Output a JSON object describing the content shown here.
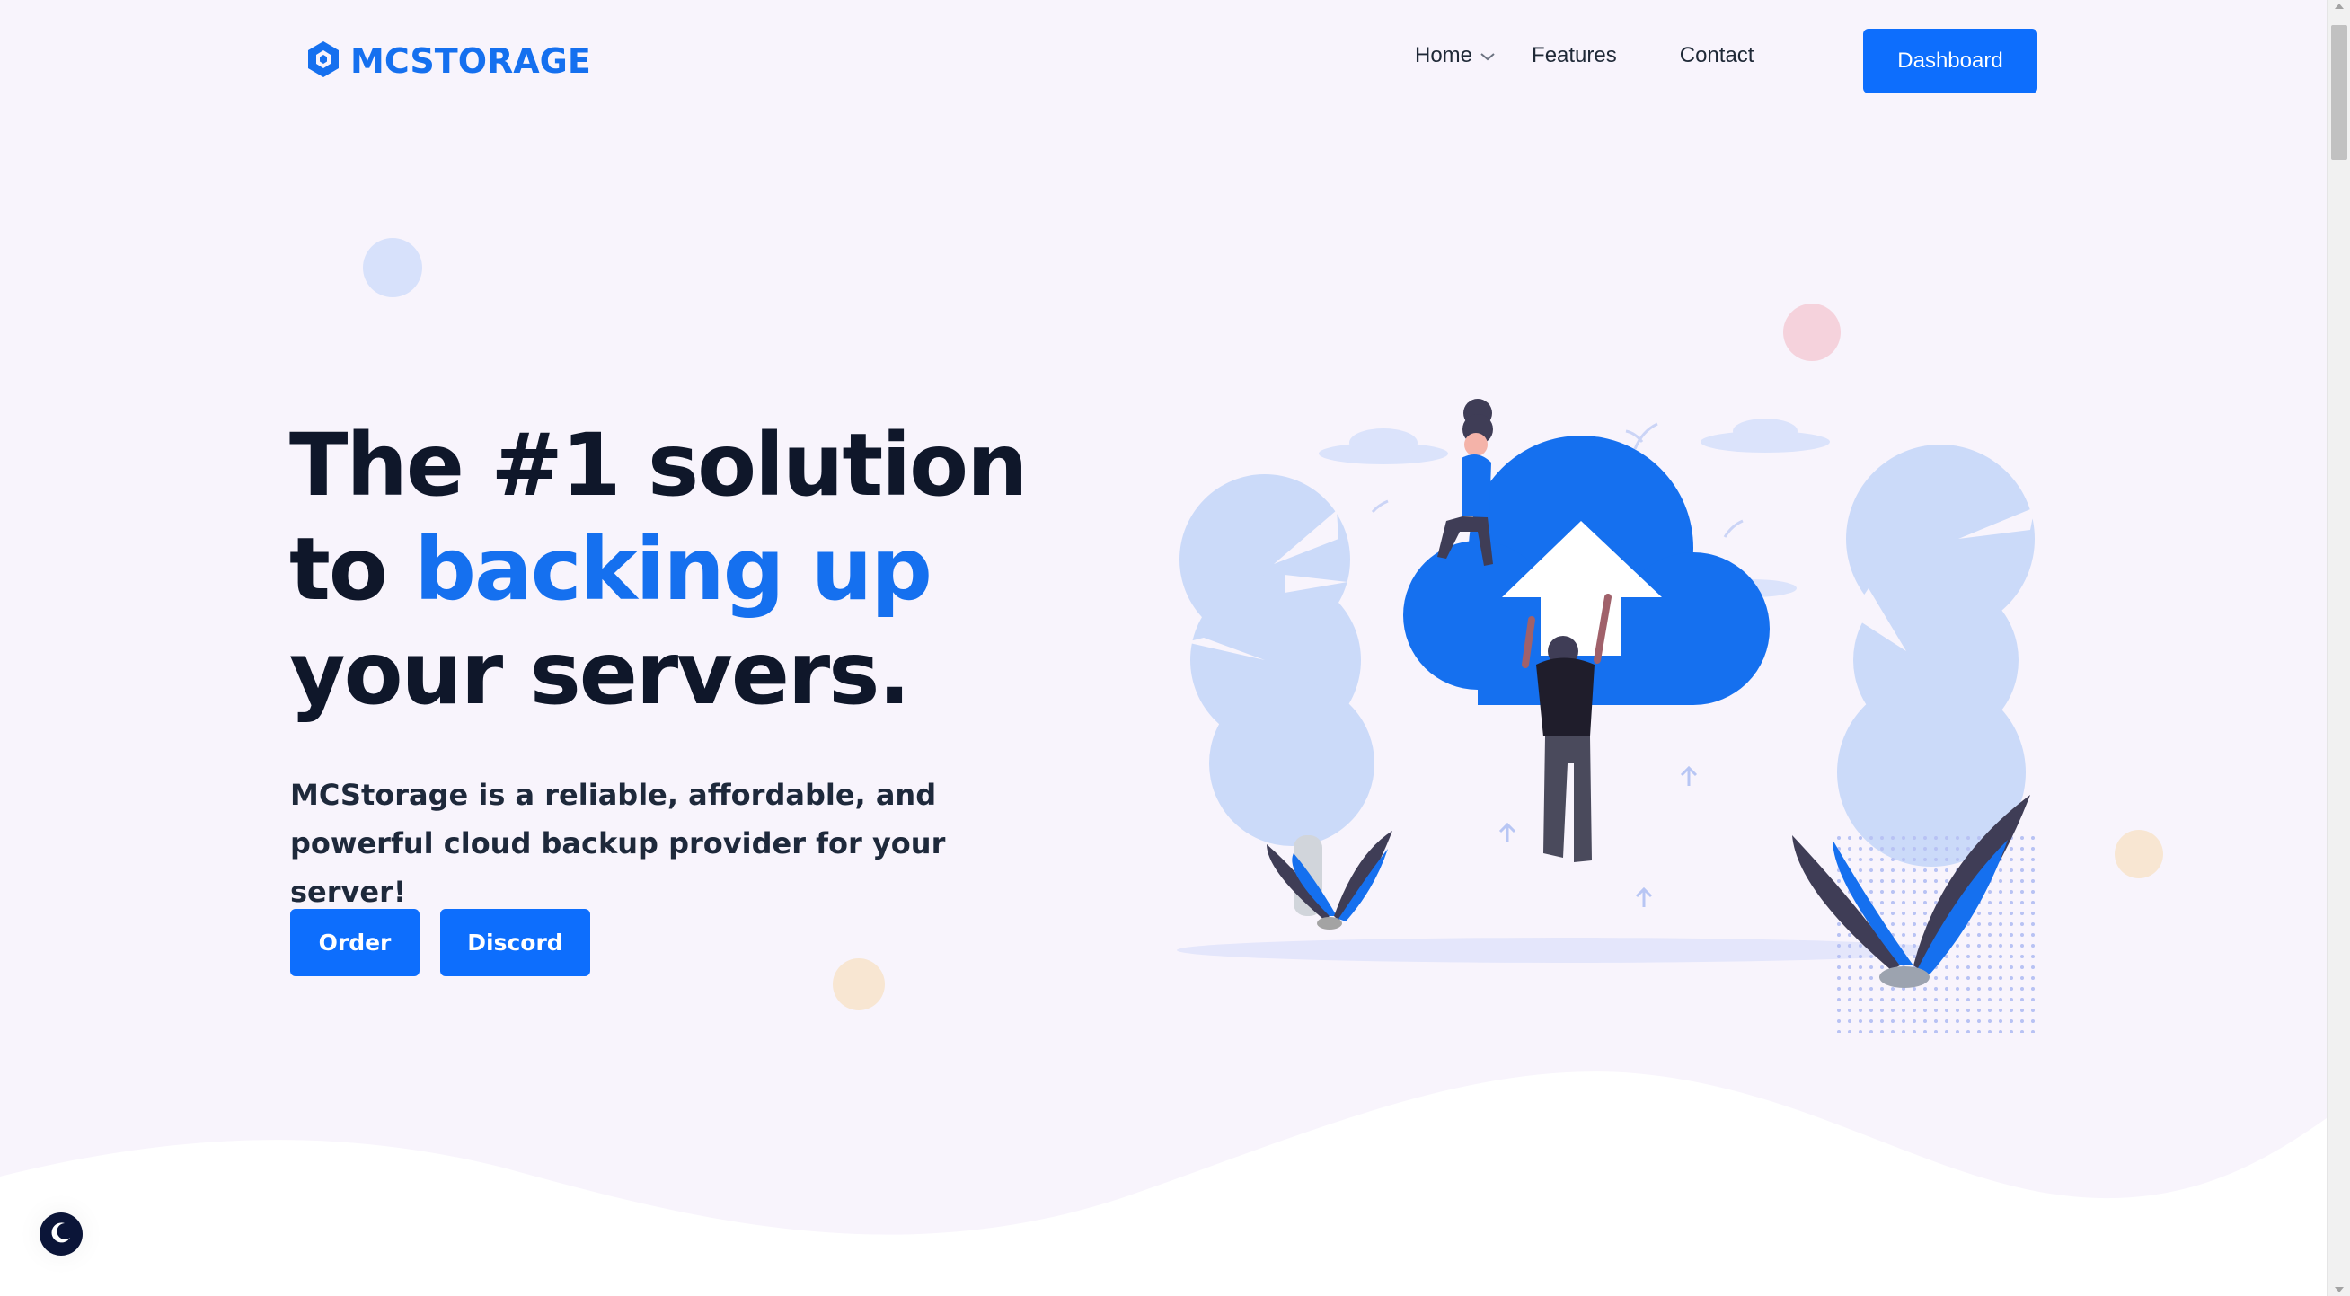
{
  "brand": {
    "name": "MCSTORAGE",
    "color": "#1570ef"
  },
  "nav": {
    "items": [
      {
        "label": "Home",
        "has_dropdown": true
      },
      {
        "label": "Features"
      },
      {
        "label": "Contact"
      }
    ],
    "dashboard_label": "Dashboard"
  },
  "hero": {
    "title_line1": "The #1 solution",
    "title_line2_prefix": "to ",
    "title_line2_highlight": "backing up",
    "title_line3": "your servers.",
    "subtitle": "MCStorage is a reliable, affordable, and powerful cloud backup provider for your server!",
    "order_label": "Order",
    "discord_label": "Discord"
  },
  "icons": {
    "logo": "cube-icon",
    "home_dropdown": "chevron-down-icon",
    "theme_toggle": "moon-icon",
    "illustration": "cloud-upload-illustration"
  },
  "colors": {
    "accent": "#0d6efd",
    "heading": "#0f172a",
    "background": "#f8f4fc"
  }
}
